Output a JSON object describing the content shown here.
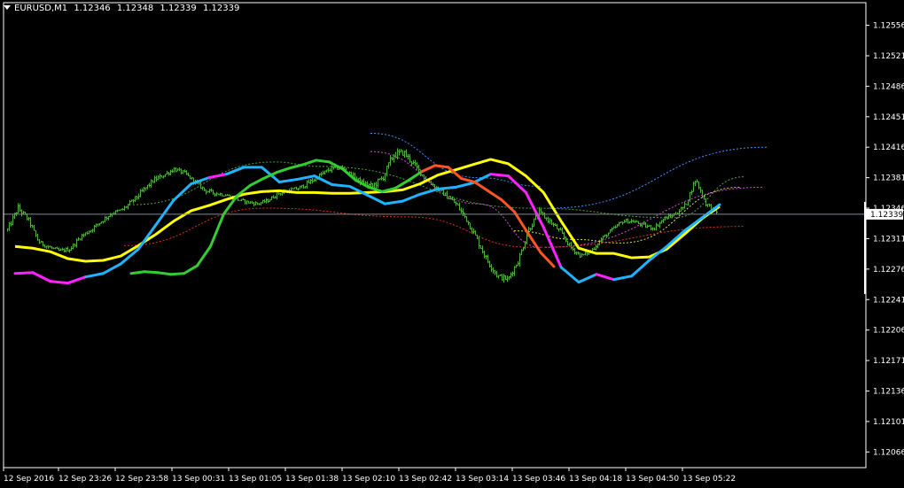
{
  "window": {
    "symbol": "EURUSD,M1",
    "open": "1.12346",
    "high": "1.12348",
    "low": "1.12339",
    "close": "1.12339"
  },
  "colors": {
    "background": "#000000",
    "axis": "#ffffff",
    "bars": "#55aa44",
    "bid_line": "#7f8a95",
    "ma_yellow": "#ffff00",
    "ma_up_cyan": "#1fb4ff",
    "ma_down_magenta": "#ff22ff",
    "ma_up_green": "#33cc33",
    "ma_down_orange": "#ff5522",
    "dash_blue": "#3f8fff",
    "dash_magenta": "#dd44dd",
    "dash_yellow": "#dddd44",
    "dash_red": "#dd3322",
    "dash_green": "#44aa33"
  },
  "chart_data": {
    "type": "line",
    "price_label": "1.12339",
    "ylim": [
      1.12048,
      1.12582
    ],
    "y_ticks": [
      "1.12556",
      "1.12521",
      "1.12486",
      "1.12451",
      "1.12416",
      "1.12381",
      "1.12346",
      "1.12311",
      "1.12276",
      "1.12241",
      "1.12206",
      "1.12171",
      "1.12136",
      "1.12101",
      "1.12066"
    ],
    "x_ticks": [
      "12 Sep 2016",
      "12 Sep 23:26",
      "12 Sep 23:58",
      "13 Sep 00:31",
      "13 Sep 01:05",
      "13 Sep 01:38",
      "13 Sep 02:10",
      "13 Sep 02:42",
      "13 Sep 03:14",
      "13 Sep 03:46",
      "13 Sep 04:18",
      "13 Sep 04:50",
      "13 Sep 05:22"
    ],
    "grid": false,
    "bars": {
      "name": "EURUSD,M1",
      "close": [
        1.12321,
        1.12346,
        1.12333,
        1.12307,
        1.12301,
        1.12297,
        1.12299,
        1.12313,
        1.12321,
        1.12331,
        1.1234,
        1.12344,
        1.12354,
        1.12366,
        1.12378,
        1.12384,
        1.12391,
        1.12386,
        1.12376,
        1.12366,
        1.12363,
        1.12361,
        1.12356,
        1.12353,
        1.12351,
        1.12355,
        1.12363,
        1.12366,
        1.12369,
        1.12376,
        1.12384,
        1.12391,
        1.12393,
        1.12384,
        1.12375,
        1.12371,
        1.12381,
        1.12407,
        1.1241,
        1.12396,
        1.12381,
        1.12371,
        1.12361,
        1.12351,
        1.12334,
        1.12311,
        1.12286,
        1.12268,
        1.12264,
        1.12286,
        1.12322,
        1.12341,
        1.12331,
        1.12319,
        1.12301,
        1.12291,
        1.12297,
        1.12311,
        1.12321,
        1.12331,
        1.12331,
        1.12326,
        1.12323,
        1.12334,
        1.12339,
        1.12349,
        1.12379,
        1.12351,
        1.12341
      ],
      "ranges": [
        6,
        8,
        6,
        5,
        5,
        4,
        5,
        5,
        5,
        6,
        5,
        5,
        6,
        6,
        6,
        5,
        5,
        5,
        5,
        5,
        5,
        4,
        4,
        4,
        4,
        4,
        5,
        5,
        5,
        6,
        6,
        6,
        5,
        5,
        6,
        7,
        8,
        10,
        8,
        7,
        6,
        6,
        6,
        7,
        8,
        8,
        7,
        7,
        6,
        7,
        8,
        7,
        6,
        6,
        6,
        5,
        5,
        5,
        5,
        5,
        5,
        5,
        5,
        5,
        5,
        6,
        7,
        6,
        6
      ]
    },
    "series": [
      {
        "name": "",
        "style": "ma_yellow",
        "values": [
          1.12302,
          1.123,
          1.12296,
          1.12288,
          1.12285,
          1.12286,
          1.12291,
          1.12303,
          1.12316,
          1.12331,
          1.12343,
          1.12349,
          1.12356,
          1.12362,
          1.12365,
          1.12366,
          1.12364,
          1.12364,
          1.12363,
          1.12363,
          1.12364,
          1.12365,
          1.12367,
          1.12374,
          1.12384,
          1.1239,
          1.12396,
          1.12402,
          1.12397,
          1.12383,
          1.12364,
          1.12331,
          1.123,
          1.12294,
          1.12294,
          1.12289,
          1.1229,
          1.12299,
          1.12316,
          1.12334,
          1.12348
        ]
      },
      {
        "name": "",
        "style": "ma_multi",
        "values": [
          1.12271,
          1.12272,
          1.12262,
          1.1226,
          1.12267,
          1.12271,
          1.12282,
          1.12299,
          1.12327,
          1.12355,
          1.12374,
          1.12381,
          1.12385,
          1.12393,
          1.12393,
          1.12376,
          1.12379,
          1.12383,
          1.12373,
          1.12371,
          1.12361,
          1.12351,
          1.12354,
          1.12362,
          1.12368,
          1.1237,
          1.12375,
          1.12385,
          1.12383,
          1.12364,
          1.12324,
          1.12278,
          1.12261,
          1.1227,
          1.12264,
          1.12268,
          1.12286,
          1.12302,
          1.1232,
          1.12335,
          1.1235
        ],
        "segment_colors": [
          "ma_down_magenta",
          "ma_down_magenta",
          "ma_down_magenta",
          "ma_down_magenta",
          "ma_up_cyan",
          "ma_up_cyan",
          "ma_up_cyan",
          "ma_up_cyan",
          "ma_up_cyan",
          "ma_up_cyan",
          "ma_up_cyan",
          "ma_down_magenta",
          "ma_up_cyan",
          "ma_up_cyan",
          "ma_up_cyan",
          "ma_up_cyan",
          "ma_up_cyan",
          "ma_up_cyan",
          "ma_up_cyan",
          "ma_up_cyan",
          "ma_up_cyan",
          "ma_up_cyan",
          "ma_up_cyan",
          "ma_up_cyan",
          "ma_up_cyan",
          "ma_up_cyan",
          "ma_up_cyan",
          "ma_down_magenta",
          "ma_down_magenta",
          "ma_down_magenta",
          "ma_down_magenta",
          "ma_up_cyan",
          "ma_up_cyan",
          "ma_down_magenta",
          "ma_up_cyan",
          "ma_up_cyan",
          "ma_up_cyan",
          "ma_up_cyan",
          "ma_up_cyan",
          "ma_up_cyan"
        ]
      },
      {
        "name": "",
        "style": "ma_multi",
        "values": [
          1.12271,
          1.12273,
          1.12272,
          1.1227,
          1.12271,
          1.1228,
          1.12302,
          1.12339,
          1.1236,
          1.12372,
          1.1238,
          1.12387,
          1.12392,
          1.12396,
          1.12401,
          1.12399,
          1.12391,
          1.12378,
          1.1237,
          1.12365,
          1.12369,
          1.12378,
          1.12388,
          1.12395,
          1.12393,
          1.1238,
          1.12376,
          1.12366,
          1.12356,
          1.12342,
          1.12318,
          1.12295,
          1.12279
        ],
        "segment_colors": [
          "ma_up_green",
          "ma_up_green",
          "ma_up_green",
          "ma_up_green",
          "ma_up_green",
          "ma_up_green",
          "ma_up_green",
          "ma_up_green",
          "ma_up_green",
          "ma_up_green",
          "ma_up_green",
          "ma_up_green",
          "ma_up_green",
          "ma_up_green",
          "ma_up_green",
          "ma_up_green",
          "ma_up_green",
          "ma_up_green",
          "ma_up_green",
          "ma_up_green",
          "ma_up_green",
          "ma_up_green",
          "ma_down_orange",
          "ma_down_orange",
          "ma_down_orange",
          "ma_down_orange",
          "ma_down_orange",
          "ma_down_orange",
          "ma_down_orange",
          "ma_down_orange",
          "ma_down_orange",
          "ma_down_orange"
        ]
      }
    ],
    "projections": [
      {
        "style": "dash_blue",
        "values": [
          [
            1.12432,
            1.12381,
            1.12371,
            null
          ],
          [
            null,
            null,
            1.12346,
            1.12416
          ]
        ]
      },
      {
        "style": "dash_magenta",
        "values": [
          [
            1.12411,
            1.12351,
            1.12301,
            null
          ],
          [
            null,
            null,
            1.12301,
            1.1237
          ]
        ]
      },
      {
        "style": "dash_yellow",
        "values": [
          [
            1.1232,
            1.1231,
            1.12306,
            1.1237
          ]
        ]
      },
      {
        "style": "dash_red",
        "values": [
          [
            1.12303,
            1.12346,
            1.12336,
            1.12301,
            1.12325
          ]
        ]
      },
      {
        "style": "dash_green",
        "values": [
          [
            1.1235,
            1.12399,
            1.12394,
            1.12346,
            1.12335,
            1.12382
          ]
        ]
      }
    ]
  }
}
